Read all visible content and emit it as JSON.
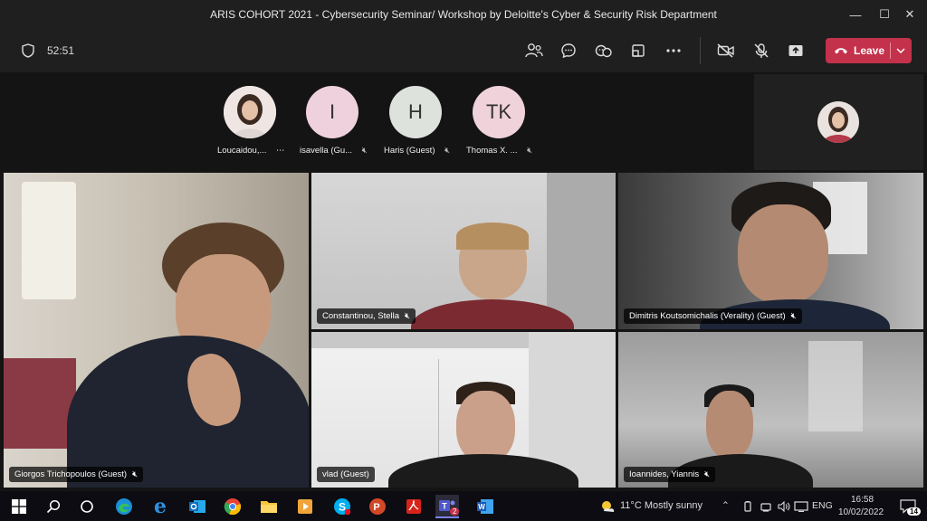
{
  "window": {
    "title": "ARIS COHORT 2021 - Cybersecurity Seminar/ Workshop by Deloitte's Cyber & Security Risk Department"
  },
  "toolbar": {
    "timer": "52:51",
    "leave_label": "Leave"
  },
  "strip": [
    {
      "initials": "",
      "name": "Loucaidou,...",
      "color": "#f0e4e4"
    },
    {
      "initials": "I",
      "name": "isavella (Gu...",
      "color": "#eed1dc"
    },
    {
      "initials": "H",
      "name": "Haris (Guest)",
      "color": "#dde2dc"
    },
    {
      "initials": "TK",
      "name": "Thomas X. ...",
      "color": "#f0d2da"
    }
  ],
  "tiles": [
    {
      "name": "Giorgos Trichopoulos (Guest)"
    },
    {
      "name": "Constantinou, Stella"
    },
    {
      "name": "Dimitris Koutsomichalis (Verality) (Guest)"
    },
    {
      "name": "vlad (Guest)"
    },
    {
      "name": "Ioannides, Yiannis"
    }
  ],
  "taskbar": {
    "weather": "11°C  Mostly sunny",
    "lang": "ENG",
    "time": "16:58",
    "date": "10/02/2022",
    "notifications": "14",
    "teams_badge": "2"
  }
}
